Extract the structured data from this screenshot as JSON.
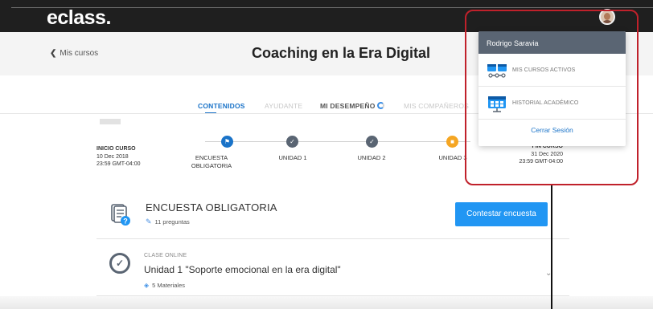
{
  "topbar": {
    "logo": "eclass",
    "logo_dot": "."
  },
  "header": {
    "back_label": "Mis cursos",
    "course_title": "Coaching en la Era Digital"
  },
  "tabs": [
    {
      "label": "CONTENIDOS",
      "state": "active"
    },
    {
      "label": "AYUDANTE",
      "state": "disabled"
    },
    {
      "label": "MI DESEMPEÑO",
      "state": "normal"
    },
    {
      "label": "MIS COMPAÑEROS",
      "state": "disabled"
    }
  ],
  "timeline": {
    "start": {
      "title": "INICIO CURSO",
      "date": "10 Dec 2018",
      "time": "23:59 GMT-04:00"
    },
    "end": {
      "title": "FIN CURSO",
      "date": "31 Dec 2020",
      "time": "23:59 GMT-04:00"
    },
    "steps": [
      {
        "label_line1": "ENCUESTA",
        "label_line2": "OBLIGATORIA",
        "status": "flag"
      },
      {
        "label_line1": "UNIDAD 1",
        "label_line2": "",
        "status": "done"
      },
      {
        "label_line1": "UNIDAD 2",
        "label_line2": "",
        "status": "done"
      },
      {
        "label_line1": "UNIDAD 3",
        "label_line2": "",
        "status": "locked"
      }
    ]
  },
  "survey": {
    "title": "ENCUESTA OBLIGATORIA",
    "questions": "11 preguntas",
    "button": "Contestar encuesta"
  },
  "class_item": {
    "kicker": "CLASE ONLINE",
    "title": "Unidad 1 \"Soporte emocional en la era digital\"",
    "materials": "5 Materiales"
  },
  "dropdown": {
    "user_name": "Rodrigo Saravia",
    "items": [
      {
        "label": "MIS CURSOS ACTIVOS",
        "icon": "courses-icon"
      },
      {
        "label": "HISTORIAL ACADÉMICO",
        "icon": "history-icon"
      }
    ],
    "logout": "Cerrar Sesión"
  },
  "colors": {
    "accent": "#1a73c8",
    "button": "#2196f3",
    "topbar": "#1f1f1f",
    "dropdown_header": "#5a6573",
    "annotation": "#c0212b",
    "locked": "#f5a623"
  },
  "icons": {
    "back": "chevron-left-icon",
    "survey": "survey-doc-icon",
    "pencil": "pencil-icon",
    "check": "check-circle-icon",
    "materials": "layers-icon",
    "expand": "chevron-down-icon"
  }
}
